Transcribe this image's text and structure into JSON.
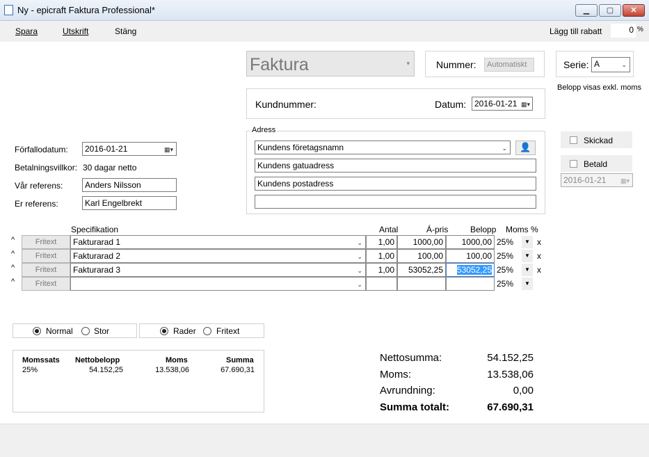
{
  "window": {
    "title": "Ny - epicraft Faktura Professional*"
  },
  "menu": {
    "save": "Spara",
    "print": "Utskrift",
    "close": "Stäng"
  },
  "discount": {
    "label": "Lägg till rabatt",
    "value": "0",
    "unit": "%"
  },
  "doc_type": "Faktura",
  "number": {
    "label": "Nummer:",
    "value": "Automatiskt"
  },
  "series": {
    "label": "Serie:",
    "value": "A"
  },
  "amount_note": "Belopp visas exkl. moms",
  "customer": {
    "number_label": "Kundnummer:",
    "date_label": "Datum:",
    "date_value": "2016-01-21"
  },
  "address": {
    "legend": "Adress",
    "company": "Kundens företagsnamn",
    "street": "Kundens gatuadress",
    "postal": "Kundens postadress",
    "extra": ""
  },
  "status": {
    "sent_label": "Skickad",
    "paid_label": "Betald",
    "paid_date": "2016-01-21"
  },
  "terms": {
    "due_label": "Förfallodatum:",
    "due_value": "2016-01-21",
    "payment_label": "Betalningsvillkor:",
    "payment_value": "30 dagar netto",
    "our_ref_label": "Vår referens:",
    "our_ref_value": "Anders Nilsson",
    "their_ref_label": "Er referens:",
    "their_ref_value": "Karl Engelbrekt"
  },
  "rows_header": {
    "spec": "Specifikation",
    "qty": "Antal",
    "price": "Á-pris",
    "amount": "Belopp",
    "vat": "Moms %"
  },
  "rows": [
    {
      "up": "^",
      "btn": "Fritext",
      "spec": "Fakturarad 1",
      "qty": "1,00",
      "price": "1000,00",
      "amount": "1000,00",
      "vat": "25%",
      "del": "x"
    },
    {
      "up": "^",
      "btn": "Fritext",
      "spec": "Fakturarad 2",
      "qty": "1,00",
      "price": "100,00",
      "amount": "100,00",
      "vat": "25%",
      "del": "x"
    },
    {
      "up": "^",
      "btn": "Fritext",
      "spec": "Fakturarad 3",
      "qty": "1,00",
      "price": "53052,25",
      "amount": "53052,25",
      "vat": "25%",
      "del": "x"
    },
    {
      "up": "^",
      "btn": "Fritext",
      "spec": "",
      "qty": "",
      "price": "",
      "amount": "",
      "vat": "25%",
      "del": ""
    }
  ],
  "size_options": {
    "normal": "Normal",
    "large": "Stor"
  },
  "view_options": {
    "rows": "Rader",
    "freetext": "Fritext"
  },
  "vat_table": {
    "headers": {
      "rate": "Momssats",
      "net": "Nettobelopp",
      "vat": "Moms",
      "sum": "Summa"
    },
    "row": {
      "rate": "25%",
      "net": "54.152,25",
      "vat": "13.538,06",
      "sum": "67.690,31"
    }
  },
  "totals": {
    "net_label": "Nettosumma:",
    "net_value": "54.152,25",
    "vat_label": "Moms:",
    "vat_value": "13.538,06",
    "rounding_label": "Avrundning:",
    "rounding_value": "0,00",
    "total_label": "Summa totalt:",
    "total_value": "67.690,31"
  }
}
